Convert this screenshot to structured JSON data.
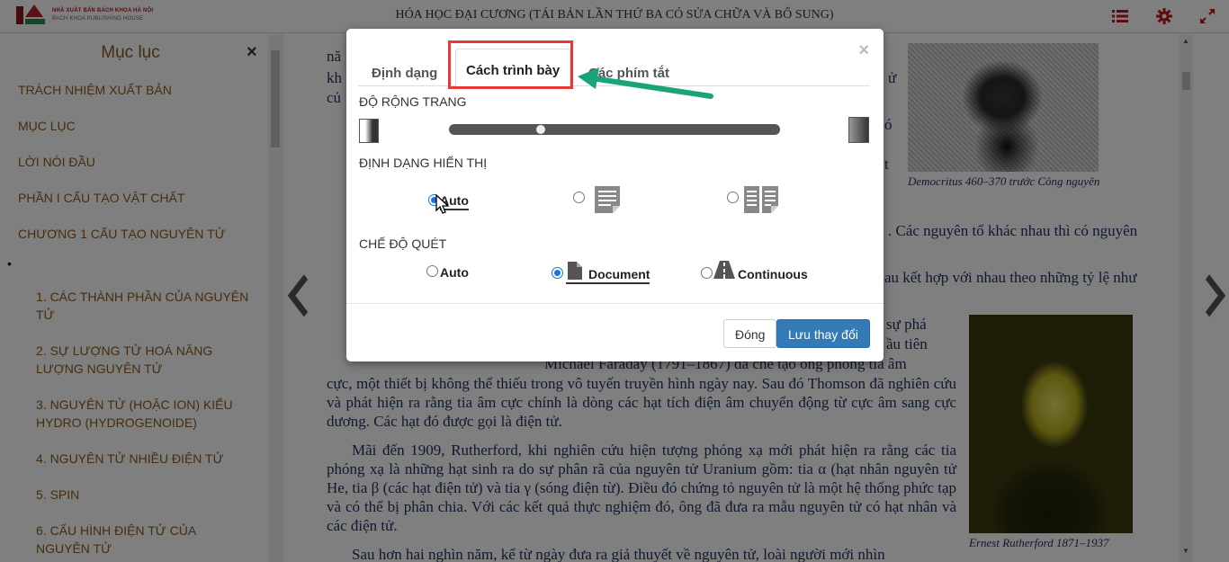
{
  "header": {
    "logo_line1": "NHÀ XUẤT BẢN BÁCH KHOA HÀ NỘI",
    "logo_line2": "BACH KHOA PUBLISHING HOUSE",
    "book_title": "HÓA HỌC ĐẠI CƯƠNG (TÁI BẢN LẦN THỨ BA CÓ SỬA CHỮA VÀ BỔ SUNG)",
    "icons": [
      "list-icon",
      "gear-icon",
      "expand-icon"
    ]
  },
  "toc": {
    "title": "Mục lục",
    "close": "×",
    "items": [
      "TRÁCH NHIỆM XUẤT BẢN",
      "MỤC LỤC",
      "LỜI NÓI ĐẦU",
      "PHẦN I CẤU TẠO VẬT CHẤT",
      "CHƯƠNG 1 CẤU TẠO NGUYÊN TỬ"
    ],
    "bullet": "•",
    "subitems": [
      "1. CÁC THÀNH PHẦN CỦA NGUYÊN TỬ",
      "2. SỰ LƯỢNG TỬ HOÁ NĂNG LƯỢNG NGUYÊN TỬ",
      "3. NGUYÊN TỬ (HOẶC ION) KIỂU HYDRO (HYDROGENOIDE)",
      "4. NGUYÊN TỬ NHIỀU ĐIỆN TỬ",
      "5. SPIN",
      "6. CẤU HÌNH ĐIỆN TỬ CỦA NGUYÊN TỬ"
    ]
  },
  "page": {
    "frag_top1": "nă",
    "frag_top2": "kh",
    "frag_top3": "củ",
    "frag_r1": "ử",
    "frag_r2": "ó",
    "frag_r3": "t",
    "line_a": ". Các nguyên tố khác nhau thì có nguyên",
    "line_b": "au kết hợp với nhau theo những tỷ lệ như",
    "line_c": "sự phá",
    "line_d": "ầu tiên",
    "line_e": "Michael Faraday (1791–1867) đã chế tạo ống phóng tia âm",
    "para1": "cực, một thiết bị không thể thiếu trong vô tuyến truyền hình ngày nay. Sau đó Thomson đã nghiên cứu và phát hiện ra rằng tia âm cực chính là dòng các hạt tích điện âm chuyển động từ cực âm sang cực dương. Các hạt đó được gọi là điện tử.",
    "para2": "Mãi đến 1909, Rutherford, khi nghiên cứu hiện tượng phóng xạ mới phát hiện ra rằng các tia phóng xạ là những hạt sinh ra do sự phân rã của nguyên tử Uranium gồm: tia α (hạt nhân nguyên tử He, tia β (các hạt điện tử) và tia γ (sóng điện từ). Điều đó chứng tỏ nguyên tử là một hệ thống phức tạp và có thể bị phân chia. Với các kết quả thực nghiệm đó, ông đã đưa ra mẫu nguyên tử có hạt nhân và các điện tử.",
    "para3": "Sau hơn hai nghìn năm, kể từ ngày đưa ra giả thuyết về nguyên tử, loài người mới nhìn",
    "caption1": "Democritus 460–370 trước Công nguyên",
    "caption2": "Ernest Rutherford 1871–1937"
  },
  "modal": {
    "close": "×",
    "tabs": [
      "Định dạng",
      "Cách trình bày",
      "Các phím tắt"
    ],
    "active_tab": "Cách trình bày",
    "section_width": "ĐỘ RỘNG TRANG",
    "width_level": 0.27,
    "section_display": "ĐỊNH DẠNG HIỂN THỊ",
    "display_options": [
      "Auto"
    ],
    "display_selected": "Auto",
    "section_scan": "CHẾ ĐỘ QUÉT",
    "scan_options": [
      "Auto",
      "Document",
      "Continuous"
    ],
    "scan_selected": "Document",
    "btn_close": "Đóng",
    "btn_save": "Lưu thay đổi",
    "highlight_color": "#e53935",
    "arrow_color": "#1aa37a"
  }
}
